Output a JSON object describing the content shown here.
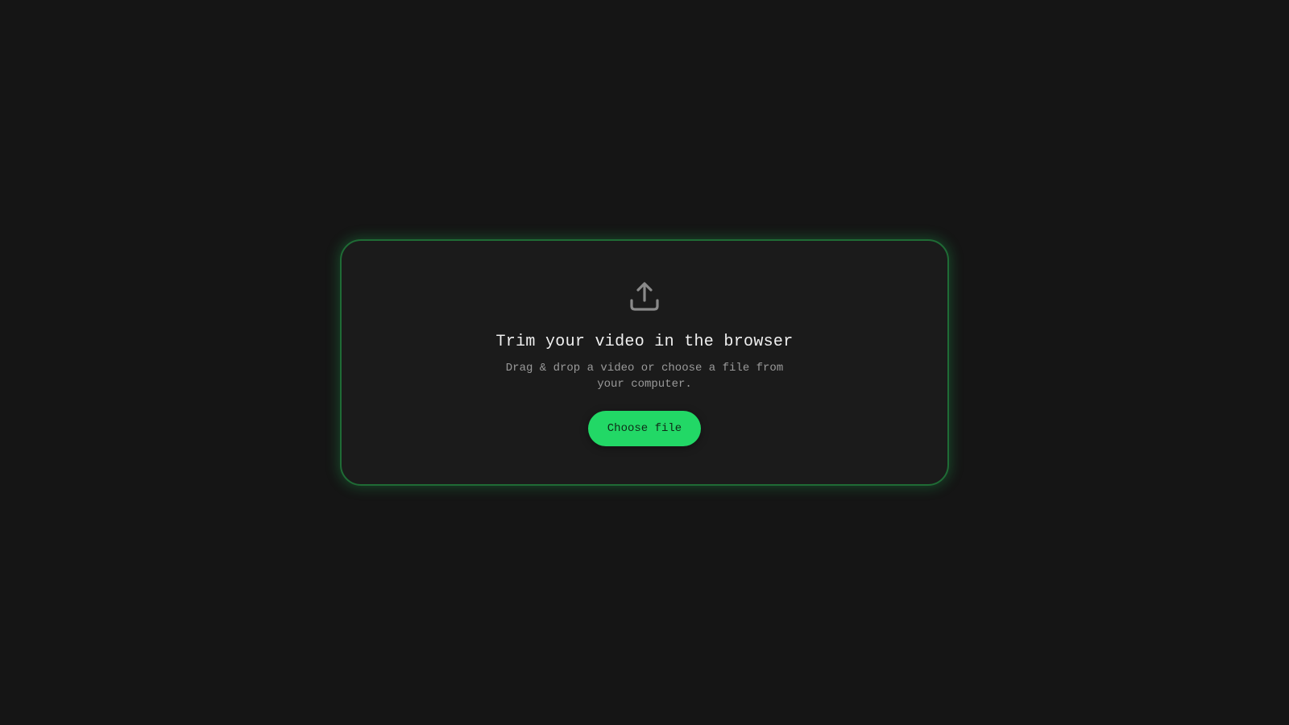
{
  "upload": {
    "icon": "upload-icon",
    "title": "Trim your video in the browser",
    "subtitle": "Drag & drop a video or choose a file from your computer.",
    "button_label": "Choose file"
  },
  "colors": {
    "background": "#151515",
    "card": "#1b1b1b",
    "accent": "#22d866",
    "border_glow": "#1f6b35"
  }
}
